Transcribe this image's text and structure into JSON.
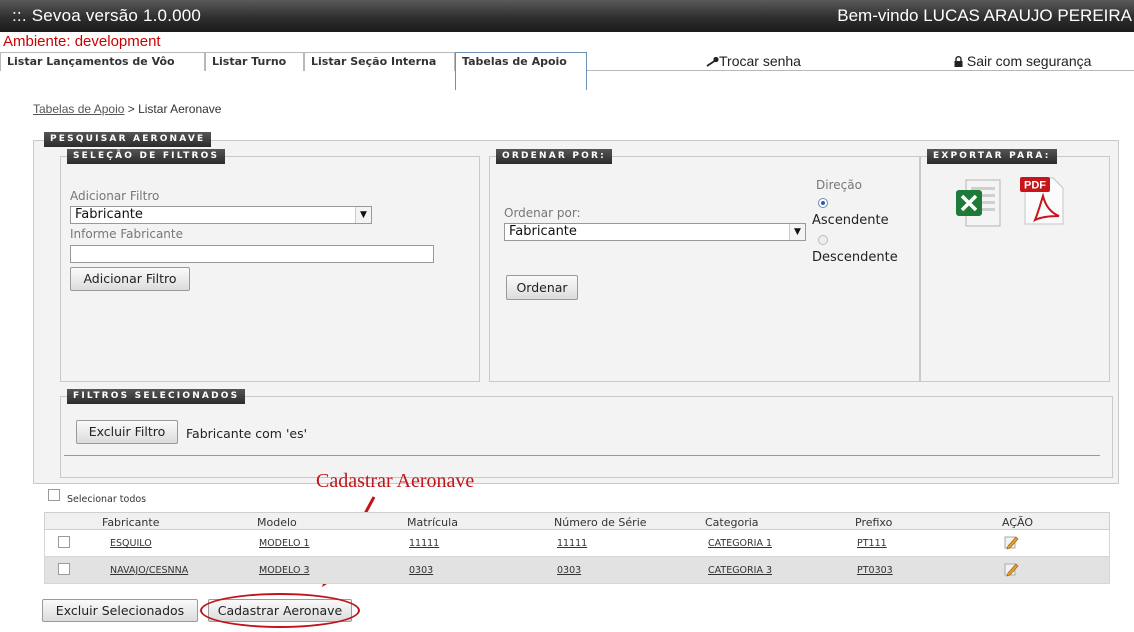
{
  "app": {
    "title": "::.  Sevoa versão 1.0.000",
    "welcome": "Bem-vindo LUCAS ARAUJO PEREIRA",
    "environment": "Ambiente: development"
  },
  "nav": {
    "tabs": [
      "Listar Lançamentos de Vôo",
      "Listar Turno",
      "Listar Seção Interna",
      "Tabelas de Apoio"
    ],
    "change_password": "Trocar senha",
    "logout": "Sair com segurança"
  },
  "breadcrumb": {
    "parent": "Tabelas de Apoio",
    "separator": " > ",
    "current": "Listar Aeronave"
  },
  "search": {
    "legend": "PESQUISAR AERONAVE",
    "filters": {
      "legend": "SELEÇÃO DE FILTROS",
      "add_filter_label": "Adicionar Filtro",
      "add_filter_value": "Fabricante",
      "inform_label": "Informe Fabricante",
      "inform_value": "",
      "add_filter_button": "Adicionar Filtro"
    },
    "order": {
      "legend": "ORDENAR POR:",
      "order_label": "Ordenar por:",
      "order_value": "Fabricante",
      "direction_label": "Direção",
      "asc": "Ascendente",
      "desc": "Descendente",
      "selected_direction": "Ascendente",
      "order_button": "Ordenar"
    },
    "export": {
      "legend": "EXPORTAR PARA:",
      "pdf_label": "PDF"
    },
    "selected": {
      "legend": "FILTROS SELECIONADOS",
      "remove_button": "Excluir Filtro",
      "active_filter": "Fabricante com 'es'"
    }
  },
  "annotation": {
    "text": "Cadastrar Aeronave",
    "color": "#c0141a"
  },
  "table": {
    "select_all": "Selecionar todos",
    "columns": [
      "Fabricante",
      "Modelo",
      "Matrícula",
      "Número de Série",
      "Categoria",
      "Prefixo",
      "AÇÃO"
    ],
    "rows": [
      [
        "ESQUILO",
        "MODELO 1",
        "11111",
        "11111",
        "CATEGORIA 1",
        "PT111"
      ],
      [
        "NAVAJO/CESNNA",
        "MODELO 3",
        "0303",
        "0303",
        "CATEGORIA 3",
        "PT0303"
      ]
    ]
  },
  "actions": {
    "delete_selected": "Excluir Selecionados",
    "register": "Cadastrar Aeronave"
  },
  "icons": {
    "key": "key-icon",
    "lock": "lock-icon",
    "excel": "excel-icon",
    "pdf": "pdf-icon",
    "edit": "pencil-edit-icon"
  }
}
